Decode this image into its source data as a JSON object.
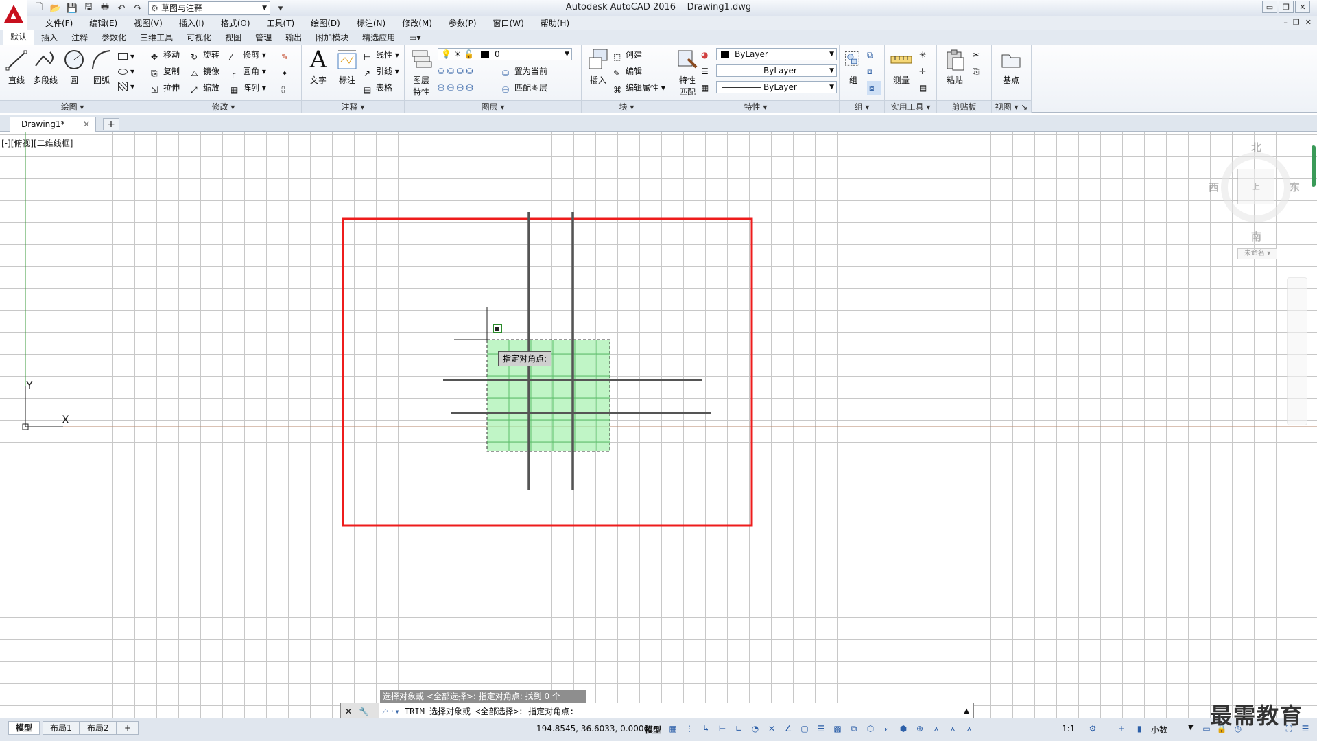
{
  "app": {
    "title": "Autodesk AutoCAD 2016",
    "filename": "Drawing1.dwg",
    "workspace": "草图与注释"
  },
  "window_controls": {
    "minimize": "▭",
    "restore": "❐",
    "close": "✕"
  },
  "menu": [
    "文件(F)",
    "编辑(E)",
    "视图(V)",
    "插入(I)",
    "格式(O)",
    "工具(T)",
    "绘图(D)",
    "标注(N)",
    "修改(M)",
    "参数(P)",
    "窗口(W)",
    "帮助(H)"
  ],
  "ribbon_tabs": [
    "默认",
    "插入",
    "注释",
    "参数化",
    "三维工具",
    "可视化",
    "视图",
    "管理",
    "输出",
    "附加模块",
    "精选应用"
  ],
  "ribbon": {
    "draw": {
      "title": "绘图",
      "line": "直线",
      "polyline": "多段线",
      "circle": "圆",
      "arc": "圆弧"
    },
    "modify": {
      "title": "修改",
      "move": "移动",
      "rotate": "旋转",
      "trim": "修剪",
      "copy": "复制",
      "mirror": "镜像",
      "fillet": "圆角",
      "stretch": "拉伸",
      "scale": "缩放",
      "array": "阵列"
    },
    "annotation": {
      "title": "注释",
      "text": "文字",
      "dimension": "标注",
      "linear": "线性",
      "leader": "引线",
      "table": "表格"
    },
    "layers": {
      "title": "图层",
      "properties_line1": "图层",
      "properties_line2": "特性",
      "current_layer": "0",
      "make_current": "置为当前",
      "match_layer": "匹配图层"
    },
    "block": {
      "title": "块",
      "insert": "插入",
      "create": "创建",
      "edit": "编辑",
      "edit_attributes": "编辑属性"
    },
    "properties": {
      "title": "特性",
      "match_line1": "特性",
      "match_line2": "匹配",
      "color": "ByLayer",
      "linetype": "ByLayer",
      "lineweight": "ByLayer"
    },
    "groups": {
      "title": "组",
      "group": "组"
    },
    "utilities": {
      "title": "实用工具",
      "measure": "测量"
    },
    "clipboard": {
      "title": "剪贴板",
      "paste": "粘贴"
    },
    "view": {
      "title": "视图",
      "base": "基点"
    }
  },
  "document": {
    "tab": "Drawing1*",
    "view_label": "[-][俯视][二维线框]"
  },
  "ucs": {
    "x": "X",
    "y": "Y"
  },
  "viewcube": {
    "north": "北",
    "south": "南",
    "east": "东",
    "west": "西",
    "top": "上",
    "ucs": "未命名 ▾"
  },
  "tooltip": "指定对角点:",
  "command": {
    "history": "选择对象或 <全部选择>:  指定对角点: 找到 0 个",
    "prompt": "TRIM 选择对象或 <全部选择>:  指定对角点:"
  },
  "layouts": [
    "模型",
    "布局1",
    "布局2"
  ],
  "status": {
    "coords": "194.8545, 36.6033, 0.0000",
    "space": "模型",
    "scale": "1:1",
    "units": "小数"
  },
  "watermark": "最需教育",
  "colors": {
    "selection_box": "#ee1c1c",
    "crossing_fill": "#9ef0a8",
    "line": "#555555",
    "ucs_origin_axis": "#3b9b3b",
    "x_axis": "#b6866a"
  }
}
